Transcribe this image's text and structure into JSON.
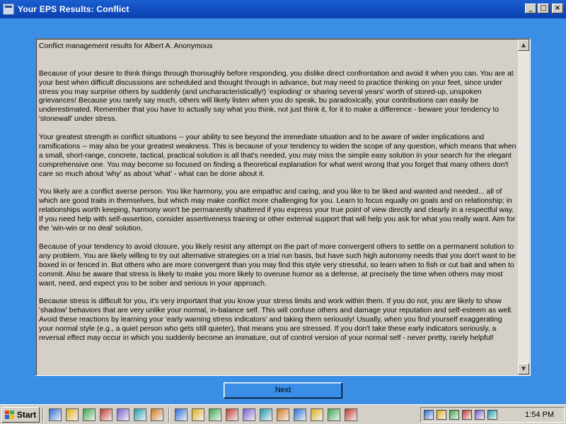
{
  "window": {
    "title": "Your EPS Results:  Conflict",
    "minimize_glyph": "_",
    "maximize_glyph": "□",
    "close_glyph": "×"
  },
  "results": {
    "header": "Conflict management results for Albert A. Anonymous",
    "paragraphs": [
      "Because of your desire to think things through thoroughly before responding, you dislike direct confrontation and avoid it when you can.  You are at your best when difficult discussions are scheduled and thought through in advance, but may need to practice thinking on your feet, since under stress you may surprise others by suddenly (and uncharacteristically!) 'exploding' or sharing several years' worth of stored-up, unspoken grievances!  Because you rarely say much, others will likely listen when you do speak, bu paradoxically, your contributions can easily be underestimated.  Remember that you have to actually say what you think, not just think it, for it to make a difference - beware your tendency to 'stonewall' under stress.",
      "Your greatest strength in conflict situations -- your ability to see beyond the immediate situation and to be aware of wider implications and ramifications -- may also be your greatest weakness.  This is because of your tendency to widen the scope of any question, which means that when a small, short-range, concrete, tactical, practical solution is all that's needed, you may miss the simple easy solution in your search for the elegant comprehensive one.  You may become so focused on finding a theoretical explanation for what went wrong that you forget that many others don't care so much about 'why' as about 'what' - what can be done about it.",
      "You likely are a conflict averse person.  You like harmony, you are empathic and caring, and you like to be liked and wanted and needed... all of which are good traits in themselves, but which may make conflict more challenging for you.  Learn to focus equally on goals and on relationship; in relationships worth keeping, harmony won't be permanently shattered if you express your true point of view directly and clearly in a respectful way.  If you need help with self-assertion, consider assertiveness training or other external support that will help you ask for what you really want.  Aim for the 'win-win or no deal' solution.",
      "Because of your tendency to avoid closure, you likely resist any attempt on the part of more convergent others to settle on a permanent solution to any problem.  You are likely willing to try out alternative strategies on a trial run basis, but have such high autonomy needs that you don't want to be boxed in or fenced in.  But others who are more convergent than you may find this style very stressful, so learn when to fish or cut bait and when to commit.  Also be aware that stress is likely to make you more likely to overuse humor as a defense, at precisely the time when others may most want, need, and expect you to be sober and serious in your approach.",
      "Because stress is difficult for you, it's very important that you know your stress limits and work within them.  If you do not, you are likely to show 'shadow' behaviors that are very unlike your normal, in-balance self.  This will confuse others and damage your reputation and self-esteem as well. Avoid these reactions by learning your 'early warning stress indicators' and taking them seriously!  Usually, when you find yourself exaggerating your normal style (e.g., a quiet person who gets still quieter), that means you are stressed.  If you don't take these early indicators seriously, a reversal effect may occur in which you suddenly become an immature, out of control version of your normal self - never pretty, rarely helpful!"
    ]
  },
  "scrollbar": {
    "up_glyph": "▲",
    "down_glyph": "▼"
  },
  "next_button": {
    "label": "Next"
  },
  "taskbar": {
    "start_label": "Start",
    "clock": "1:54 PM"
  },
  "icons": {
    "quick_launch": [
      "show-desktop-icon",
      "internet-explorer-icon",
      "network-icon",
      "grid-app-icon",
      "tool-icon",
      "cursor-app-icon",
      "media-app-icon"
    ],
    "tasks": [
      "explorer-icon",
      "search-icon",
      "chain-icon",
      "word-icon",
      "app-window-icon",
      "app-window-icon",
      "app-window-icon",
      "app-window-icon",
      "app-window-icon",
      "app-window-icon",
      "app-window-icon"
    ],
    "tray": [
      "volume-icon",
      "network-tray-icon",
      "monitor-icon",
      "printer-icon",
      "info-icon",
      "display-icon"
    ]
  }
}
